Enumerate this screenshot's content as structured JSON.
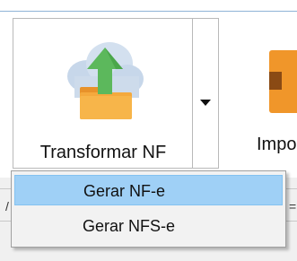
{
  "ribbon": {
    "transform_button": {
      "label": "Transformar NF",
      "icon": "cloud-upload-folder-icon"
    },
    "next_button": {
      "label_partial": "Impo",
      "icon": "document-icon"
    },
    "accent_colors": {
      "menu_highlight": "#9fd0f6",
      "folder": "#f2a93b",
      "arrow": "#5cb85c",
      "cloud": "#c7d7ea"
    }
  },
  "background_fragments": {
    "left": "/",
    "right": "="
  },
  "dropdown_menu": {
    "items": [
      {
        "label": "Gerar NF-e",
        "highlighted": true
      },
      {
        "label": "Gerar NFS-e",
        "highlighted": false
      }
    ]
  }
}
